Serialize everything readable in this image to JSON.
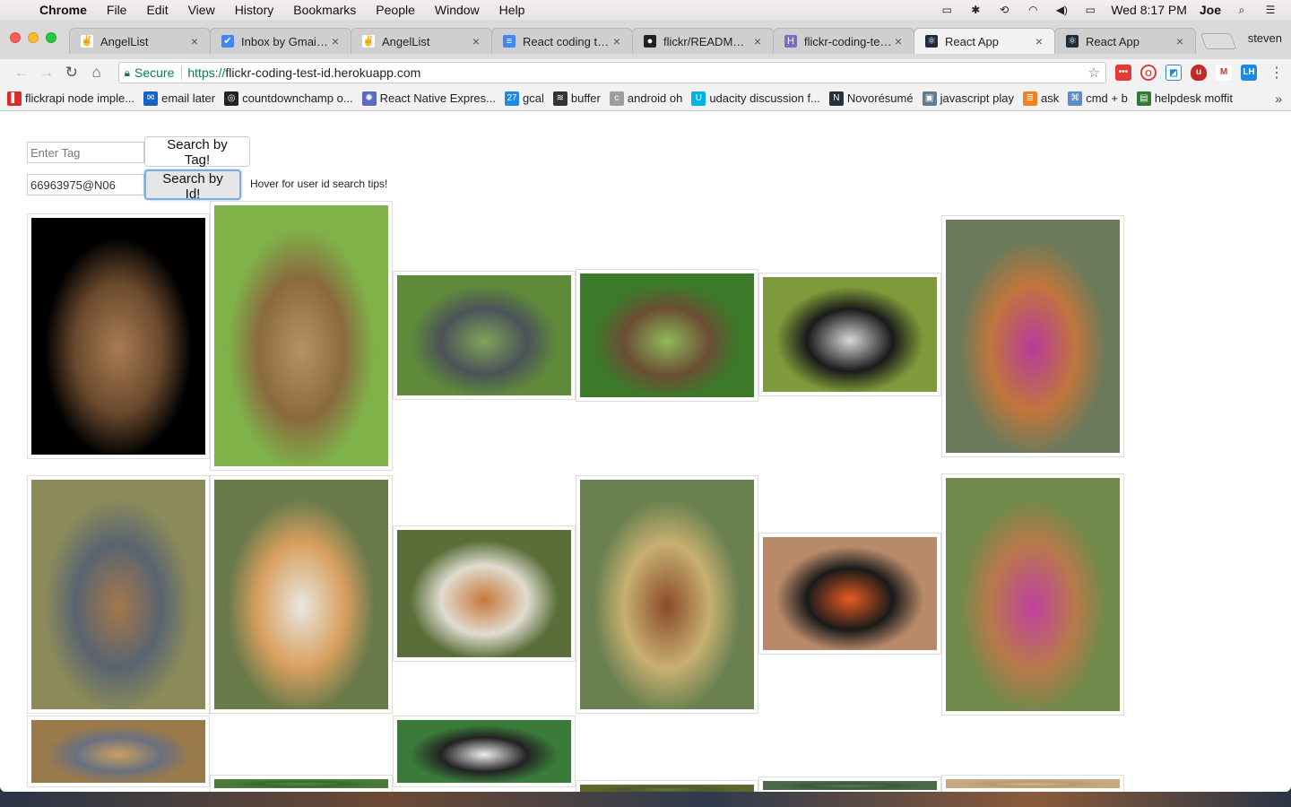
{
  "menubar": {
    "app": "Chrome",
    "items": [
      "File",
      "Edit",
      "View",
      "History",
      "Bookmarks",
      "People",
      "Window",
      "Help"
    ],
    "clock": "Wed 8:17 PM",
    "user": "Joe"
  },
  "tabs": [
    {
      "title": "AngelList",
      "icon": "angellist-icon",
      "color": "#ffffff",
      "glyph": "✌",
      "active": false
    },
    {
      "title": "Inbox by Gmail - th",
      "icon": "inbox-icon",
      "color": "#4285f4",
      "glyph": "✔",
      "active": false
    },
    {
      "title": "AngelList",
      "icon": "angellist-icon",
      "color": "#ffffff",
      "glyph": "✌",
      "active": false
    },
    {
      "title": "React coding test",
      "icon": "docs-icon",
      "color": "#4285f4",
      "glyph": "≡",
      "active": false
    },
    {
      "title": "flickr/README.md",
      "icon": "github-icon",
      "color": "#222222",
      "glyph": "●",
      "active": false
    },
    {
      "title": "flickr-coding-test-",
      "icon": "heroku-icon",
      "color": "#7f6ac2",
      "glyph": "H",
      "active": false
    },
    {
      "title": "React App",
      "icon": "react-icon",
      "color": "#1e2b3a",
      "glyph": "⚛",
      "active": true
    },
    {
      "title": "React App",
      "icon": "react-icon",
      "color": "#1e2b3a",
      "glyph": "⚛",
      "active": false
    }
  ],
  "profile": "steven",
  "address": {
    "secure_label": "Secure",
    "scheme": "https://",
    "host": "flickr-coding-test-id.herokuapp.com"
  },
  "bookmarks": [
    {
      "label": "flickrapi node imple...",
      "color": "#d32f2f",
      "glyph": "▌"
    },
    {
      "label": "email later",
      "color": "#1565c0",
      "glyph": "✉"
    },
    {
      "label": "countdownchamp o...",
      "color": "#222222",
      "glyph": "◎"
    },
    {
      "label": "React Native Expres...",
      "color": "#5c6bc0",
      "glyph": "✺"
    },
    {
      "label": "gcal",
      "color": "#1e88e5",
      "glyph": "27"
    },
    {
      "label": "buffer",
      "color": "#333333",
      "glyph": "≋"
    },
    {
      "label": "android oh",
      "color": "#9e9e9e",
      "glyph": "c"
    },
    {
      "label": "udacity discussion f...",
      "color": "#02b3e4",
      "glyph": "U"
    },
    {
      "label": "Novorésumé",
      "color": "#263238",
      "glyph": "N"
    },
    {
      "label": "javascript play",
      "color": "#607d8b",
      "glyph": "▣"
    },
    {
      "label": "ask",
      "color": "#f48024",
      "glyph": "≣"
    },
    {
      "label": "cmd + b",
      "color": "#5e8cc8",
      "glyph": "⌘"
    },
    {
      "label": "helpdesk moffit",
      "color": "#2e7d32",
      "glyph": "▤"
    }
  ],
  "search": {
    "tag_placeholder": "Enter Tag",
    "tag_button": "Search by Tag!",
    "id_value": "66963975@N06",
    "id_button": "Search by Id!",
    "tip": "Hover for user id search tips!"
  },
  "photos": [
    {
      "name": "photo-tawny-owl",
      "colors": [
        "#000000",
        "#6b4a2e",
        "#a87c52"
      ]
    },
    {
      "name": "photo-wild-boar-piglet",
      "colors": [
        "#7fb34a",
        "#8a6a3e",
        "#b59363"
      ]
    },
    {
      "name": "photo-dipper-bird",
      "colors": [
        "#5f8a3a",
        "#4b5358",
        "#7fa35a"
      ]
    },
    {
      "name": "photo-limpkin",
      "colors": [
        "#3c7a2a",
        "#6b4e34",
        "#8fb85a"
      ]
    },
    {
      "name": "photo-anhinga",
      "colors": [
        "#7f9a3a",
        "#1a1a1a",
        "#d8d8d8"
      ]
    },
    {
      "name": "photo-harvest-mice-thistle",
      "colors": [
        "#6a7a5a",
        "#c0763c",
        "#b83a9a"
      ]
    },
    {
      "name": "photo-cuckoo",
      "colors": [
        "#8a8a5a",
        "#5a6470",
        "#a2784a"
      ]
    },
    {
      "name": "photo-mouse-dandelion",
      "colors": [
        "#6a7a4a",
        "#d9a060",
        "#e8e8e0"
      ]
    },
    {
      "name": "photo-mouse-dandelion-seedhead",
      "colors": [
        "#5a6e3a",
        "#e0dcd0",
        "#c8783a"
      ]
    },
    {
      "name": "photo-mouse-wheat",
      "colors": [
        "#6a8050",
        "#c8b070",
        "#8a4a2a"
      ]
    },
    {
      "name": "photo-puffin",
      "colors": [
        "#b88a6a",
        "#1a1a1a",
        "#e85a20"
      ]
    },
    {
      "name": "photo-mouse-thistle",
      "colors": [
        "#6f8a4a",
        "#b87a4a",
        "#c040a0"
      ]
    },
    {
      "name": "photo-cuckoo-head",
      "colors": [
        "#9a7a4a",
        "#6a7080",
        "#c8a060"
      ]
    },
    {
      "name": "photo-green-partial",
      "colors": [
        "#4a7a3a",
        "#3a6a2a",
        "#5a8a4a"
      ]
    },
    {
      "name": "photo-wheatear",
      "colors": [
        "#3a7a3a",
        "#222222",
        "#eeeeee"
      ]
    },
    {
      "name": "photo-green-partial-2",
      "colors": [
        "#5a6a2a",
        "#4a5a2a",
        "#6a7a3a"
      ]
    },
    {
      "name": "photo-green-partial-3",
      "colors": [
        "#4a6a4a",
        "#3a5a3a",
        "#5a7a5a"
      ]
    },
    {
      "name": "photo-tan-partial",
      "colors": [
        "#c8a880",
        "#b89870",
        "#d8b890"
      ]
    }
  ]
}
